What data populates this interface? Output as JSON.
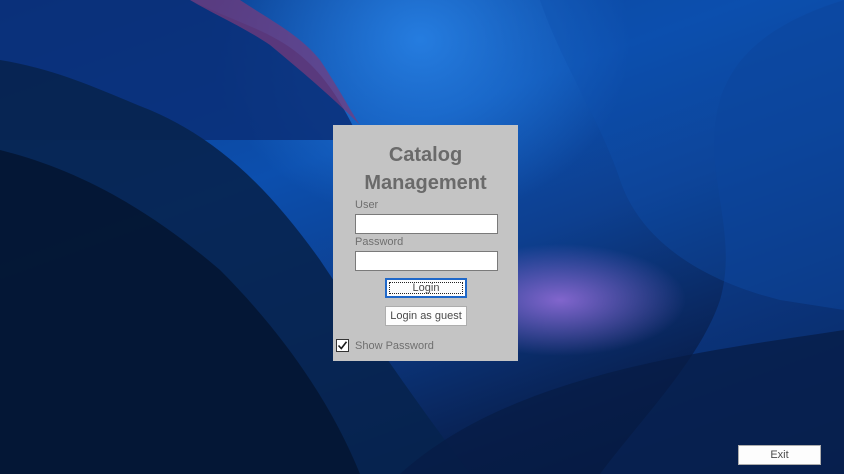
{
  "app": {
    "title": "Catalog Management"
  },
  "login_form": {
    "user_label": "User",
    "user_value": "",
    "password_label": "Password",
    "password_value": "",
    "login_label": "Login",
    "guest_label": "Login as guest",
    "show_password_label": "Show Password",
    "show_password_checked": true
  },
  "footer": {
    "exit_label": "Exit"
  },
  "colors": {
    "panel_bg": "#c4c4c4",
    "title_text": "#6a6a6a",
    "focus_border": "#1f68c9"
  },
  "icons": {
    "checkbox": "check-icon"
  }
}
